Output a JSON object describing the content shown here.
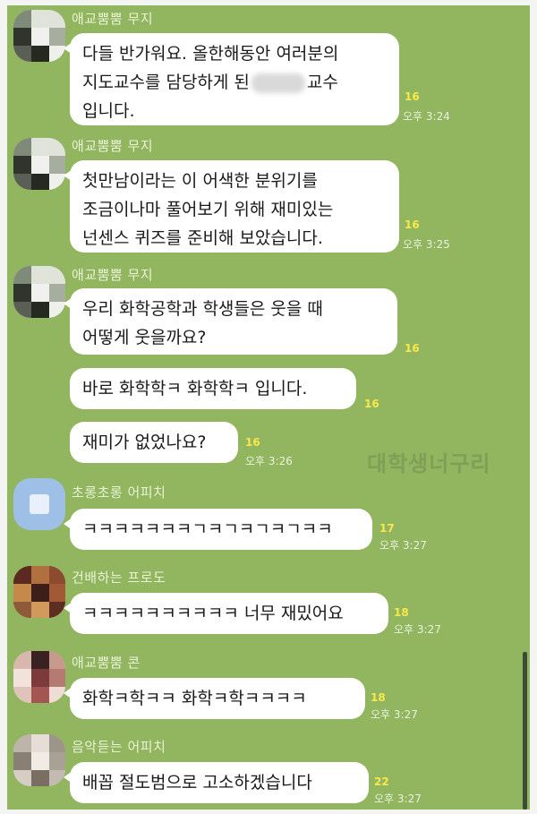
{
  "colors": {
    "chat_background": "#92b55f",
    "bubble": "#ffffff",
    "unread_count": "#fbe84a"
  },
  "messages": [
    {
      "sender": "애교뿜뿜 무지",
      "lines": [
        "다들 반가워요. 올한해동안 여러분의",
        "지도교수를 담당하게 된",
        "교수",
        "입니다."
      ],
      "unread": "16",
      "time": "오후 3:24"
    },
    {
      "sender": "애교뿜뿜 무지",
      "lines": [
        "첫만남이라는 이 어색한 분위기를",
        "조금이나마 풀어보기 위해 재미있는",
        "넌센스 퀴즈를 준비해 보았습니다."
      ],
      "unread": "16",
      "time": "오후 3:25"
    },
    {
      "sender": "애교뿜뿜 무지",
      "lines": [
        "우리 화학공학과 학생들은 웃을 때",
        "어떻게 웃을까요?"
      ],
      "unread": "16"
    },
    {
      "lines": [
        "바로 화학학ㅋ 화학학ㅋ 입니다."
      ],
      "unread": "16"
    },
    {
      "lines": [
        "재미가 없었나요?"
      ],
      "unread": "16",
      "time": "오후 3:26"
    },
    {
      "sender": "초롱초롱 어피치",
      "lines": [
        "ㅋㅋㅋㅋㅋㅋㅋㄱㅋㄱㅋㄱㅋㄱㅋㅋ"
      ],
      "unread": "17",
      "time": "오후 3:27"
    },
    {
      "sender": "건배하는 프로도",
      "lines": [
        "ㅋㅋㅋㅋㅋㅋㅋㅋㅋㅋ 너무 재밌어요"
      ],
      "unread": "18",
      "time": "오후 3:27"
    },
    {
      "sender": "애교뿜뿜 콘",
      "lines": [
        "화학ㅋ학ㅋㅋ 화학ㅋ학ㅋㅋㅋㅋ"
      ],
      "unread": "18",
      "time": "오후 3:27"
    },
    {
      "sender": "음악듣는 어피치",
      "lines": [
        "배꼽 절도범으로 고소하겠습니다"
      ],
      "unread": "22",
      "time": "오후 3:27"
    }
  ],
  "watermark": "대학생너구리",
  "icons": {
    "avatar_1": "pixelated-profile-icon",
    "avatar_2": "pixelated-profile-icon",
    "avatar_3": "pixelated-profile-icon",
    "avatar_4": "default-profile-icon",
    "avatar_5": "pixelated-profile-icon",
    "avatar_6": "pixelated-profile-icon",
    "avatar_7": "pixelated-profile-icon"
  }
}
